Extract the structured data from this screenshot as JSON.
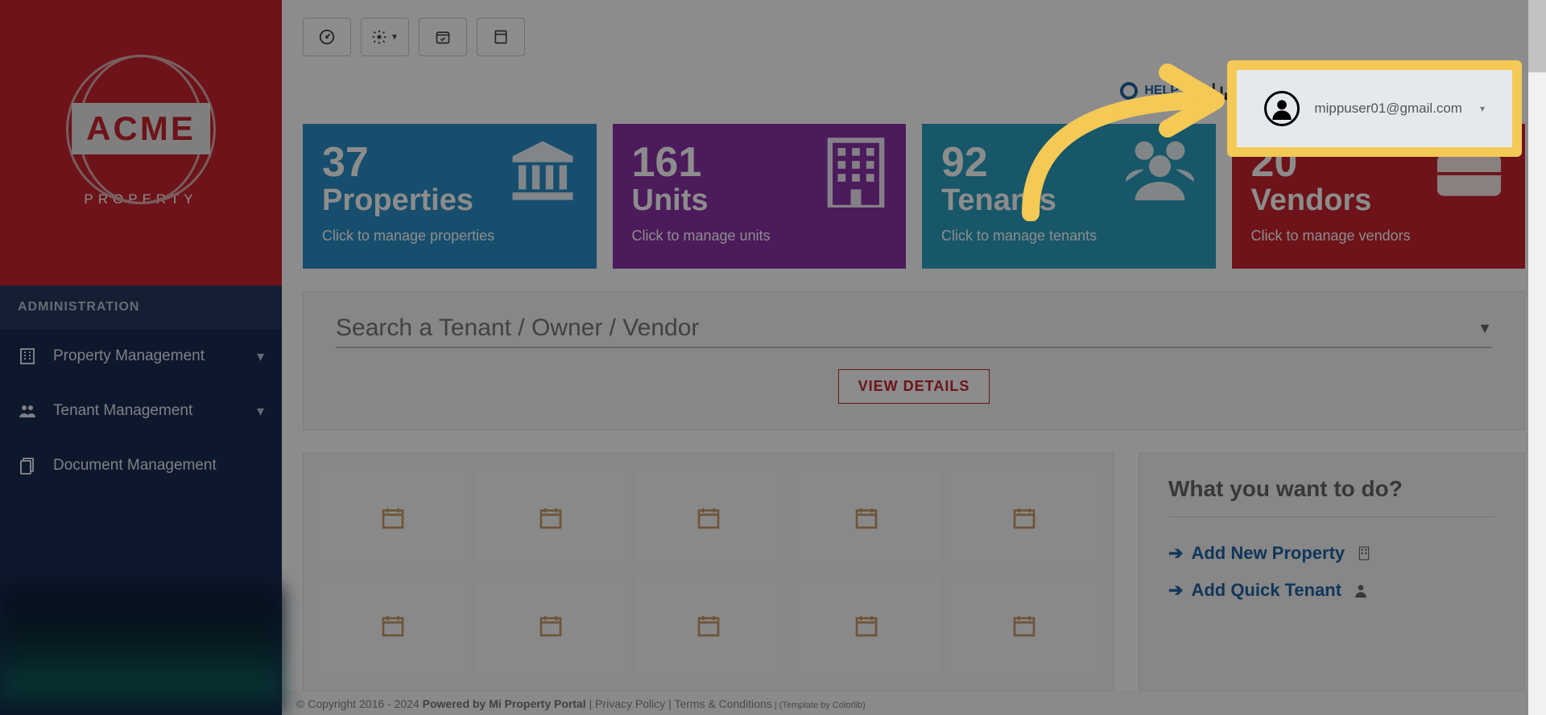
{
  "brand": {
    "name": "ACME",
    "sub": "PROPERTY"
  },
  "sidebar": {
    "section": "ADMINISTRATION",
    "items": [
      {
        "label": "Property Management",
        "icon": "building-icon",
        "expandable": true
      },
      {
        "label": "Tenant Management",
        "icon": "users-icon",
        "expandable": true
      },
      {
        "label": "Document Management",
        "icon": "documents-icon",
        "expandable": false
      }
    ]
  },
  "topbar": {
    "help": "HELP"
  },
  "user": {
    "email": "mippuser01@gmail.com"
  },
  "cards": [
    {
      "count": "37",
      "title": "Properties",
      "sub": "Click to manage properties",
      "color": "blue",
      "icon": "bank-icon"
    },
    {
      "count": "161",
      "title": "Units",
      "sub": "Click to manage units",
      "color": "purple",
      "icon": "building-grid-icon"
    },
    {
      "count": "92",
      "title": "Tenants",
      "sub": "Click to manage tenants",
      "color": "teal",
      "icon": "group-icon"
    },
    {
      "count": "20",
      "title": "Vendors",
      "sub": "Click to manage vendors",
      "color": "red",
      "icon": "briefcase-icon"
    }
  ],
  "search": {
    "placeholder": "Search a Tenant / Owner / Vendor",
    "viewDetails": "VIEW DETAILS"
  },
  "sidePanel": {
    "title": "What you want to do?",
    "actions": [
      {
        "label": "Add New Property",
        "icon": "building-small-icon"
      },
      {
        "label": "Add Quick Tenant",
        "icon": "person-small-icon"
      }
    ]
  },
  "footer": {
    "copyright": "© Copyright 2016 - 2024 ",
    "powered": "Powered by Mi Property Portal",
    "sep": " | ",
    "privacy": "Privacy Policy",
    "terms": "Terms & Conditions",
    "template": " | (Template by Colorlib)"
  }
}
